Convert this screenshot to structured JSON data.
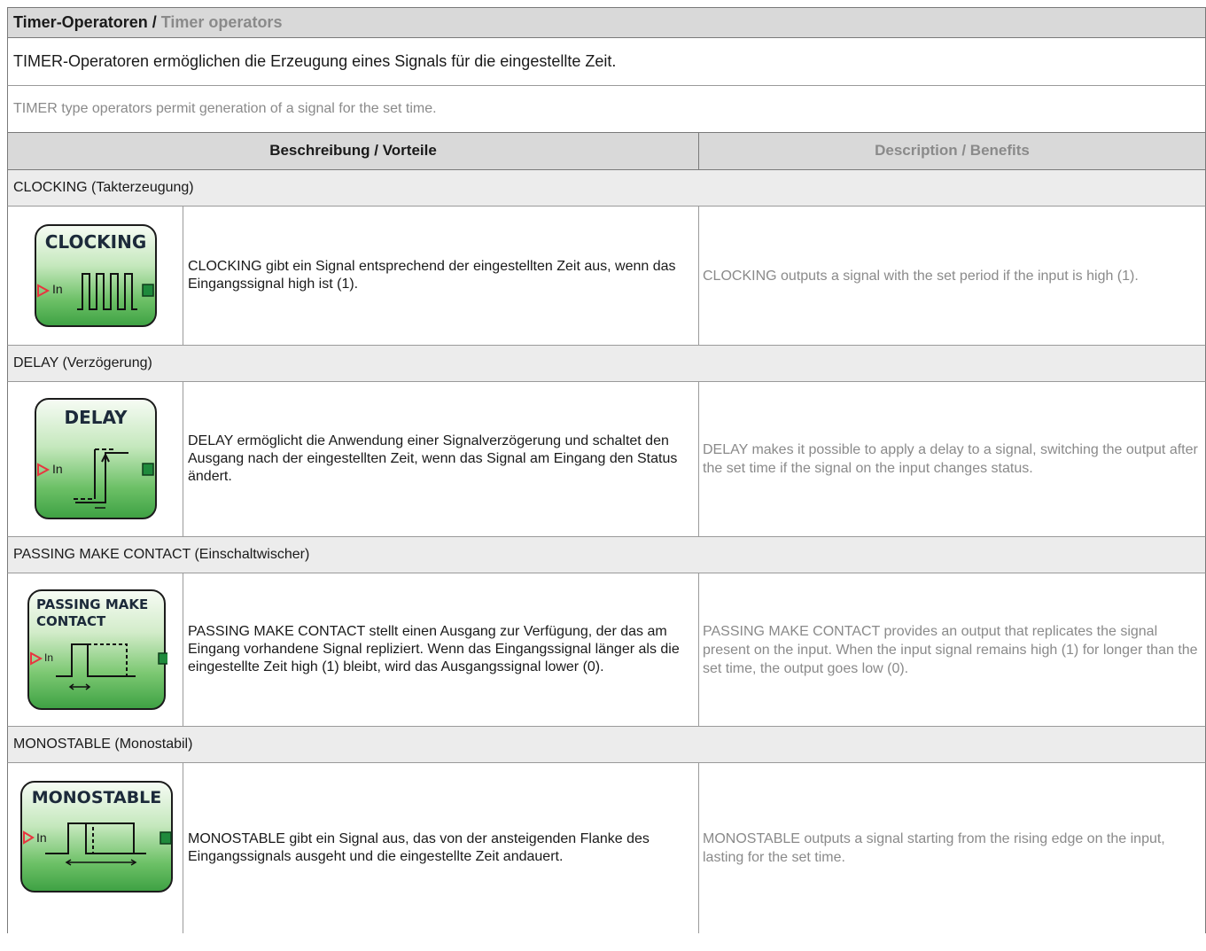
{
  "header": {
    "title_de": "Timer-Operatoren /",
    "title_en": "Timer operators"
  },
  "intro": {
    "de": "TIMER-Operatoren ermöglichen die Erzeugung eines Signals für die eingestellte Zeit.",
    "en": "TIMER type operators permit generation of a signal for the set time."
  },
  "columns": {
    "de": "Beschreibung / Vorteile",
    "en": "Description / Benefits"
  },
  "colors": {
    "header_bg": "#d9d9d9",
    "section_bg": "#ececec",
    "block_green": "#3fa244",
    "input_marker": "#e8343f",
    "output_marker": "#1f8a3c"
  },
  "sections": [
    {
      "heading": "CLOCKING (Takterzeugung)",
      "block_title": "CLOCKING",
      "input_label": "In",
      "icon": "clock-pulse-icon",
      "de": "CLOCKING gibt ein Signal entsprechend der eingestellten Zeit aus, wenn das Eingangssignal high ist (1).",
      "en": "CLOCKING outputs a signal with the set period if the input is high (1)."
    },
    {
      "heading": "DELAY (Verzögerung)",
      "block_title": "DELAY",
      "input_label": "In",
      "icon": "delay-waveform-icon",
      "de": "DELAY ermöglicht die Anwendung einer Signalverzögerung und schaltet den Ausgang nach der eingestellten Zeit, wenn das Signal am Eingang den Status ändert.",
      "en": "DELAY makes it possible to apply a delay to a signal, switching the output after the set time if the signal on the input changes status."
    },
    {
      "heading": "PASSING MAKE CONTACT (Einschaltwischer)",
      "block_title": "PASSING MAKE CONTACT",
      "input_label": "In",
      "icon": "passing-contact-waveform-icon",
      "de": "PASSING MAKE CONTACT stellt einen Ausgang zur Verfügung, der das am Eingang vorhandene Signal repliziert. Wenn das Eingangssignal länger als die eingestellte Zeit high (1) bleibt, wird das Ausgangssignal lower (0).",
      "en": "PASSING MAKE CONTACT provides an output that replicates the signal present on the input. When the input signal remains high (1) for longer than the set time, the output goes low (0)."
    },
    {
      "heading": "MONOSTABLE (Monostabil)",
      "block_title": "MONOSTABLE",
      "input_label": "In",
      "icon": "monostable-waveform-icon",
      "de": "MONOSTABLE gibt ein Signal aus, das von der ansteigenden Flanke des Eingangssignals ausgeht und die eingestellte Zeit andauert.",
      "en": "MONOSTABLE outputs a signal starting from the rising edge on the input, lasting for the set time."
    }
  ]
}
